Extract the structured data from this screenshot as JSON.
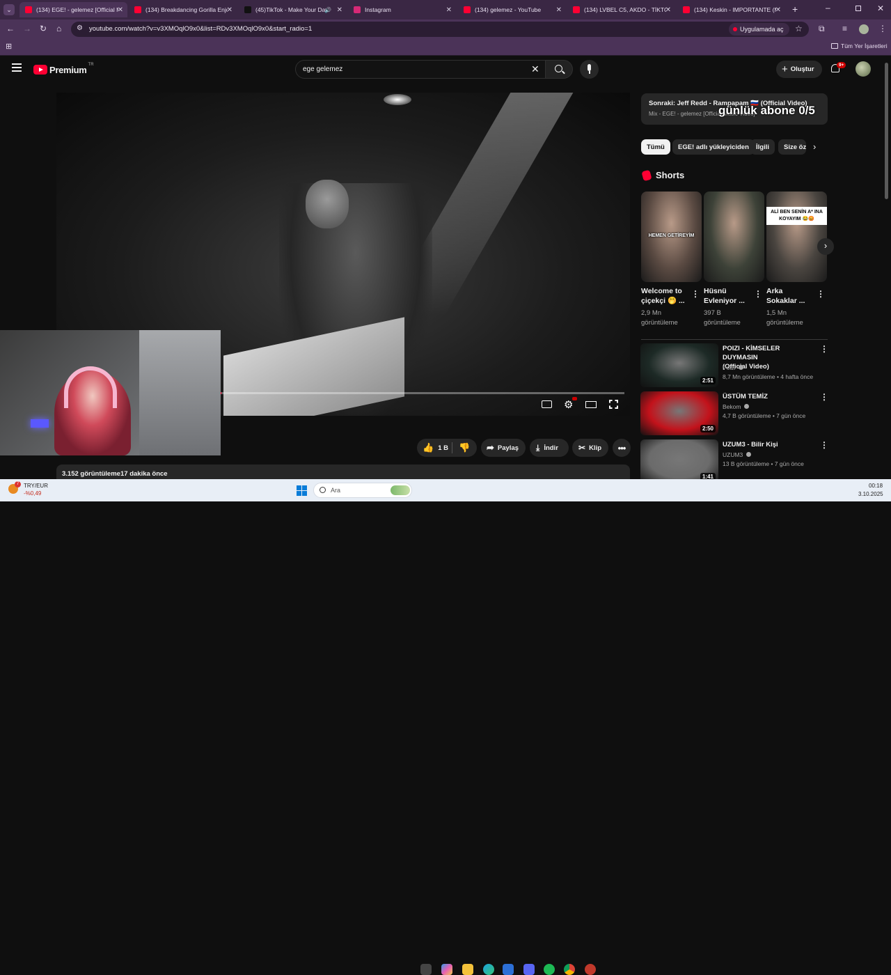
{
  "browser": {
    "tabs": [
      {
        "label": "(134) EGE! - gelemez [Official M",
        "fav": "#ff0033",
        "active": true
      },
      {
        "label": "(134) Breakdancing Gorilla Enjo",
        "fav": "#ff0033"
      },
      {
        "label": "(45)TikTok - Make Your Day",
        "fav": "#111111",
        "audio": "🔊"
      },
      {
        "label": "Instagram",
        "fav": "#d62976"
      },
      {
        "label": "(134) gelemez - YouTube",
        "fav": "#ff0033"
      },
      {
        "label": "(134) LVBEL C5, AKDO - TİKTOK",
        "fav": "#ff0033"
      },
      {
        "label": "(134) Keskin - IMPORTANTE (M",
        "fav": "#ff0033"
      }
    ],
    "new_tab": "+",
    "url": "youtube.com/watch?v=v3XMOqlO9x0&list=RDv3XMOqlO9x0&start_radio=1",
    "open_in_app": "Uygulamada aç",
    "bookmarks_label": "Tüm Yer İşaretleri"
  },
  "yt": {
    "logo_text": "Premium",
    "region": "TR",
    "search_value": "ege gelemez",
    "create_label": "Oluştur",
    "notif_badge": "9+"
  },
  "player": {
    "progress": 0.29
  },
  "actions": {
    "like_count": "1 B",
    "share_label": "Paylaş",
    "download_label": "İndir",
    "clip_label": "Klip"
  },
  "description": {
    "views": "3.152 görüntüleme",
    "time": "17 dakika önce"
  },
  "next_card": {
    "title": "Sonraki: Jeff Redd - Rampapam 🇷🇺 (Official Video)",
    "subtitle": "Mix - EGE! - gelemez [Official Music Video]",
    "overlay": "günlük abone 0/5"
  },
  "chips": [
    "Tümü",
    "EGE! adlı yükleyiciden",
    "İlgili",
    "Size öz"
  ],
  "shorts": {
    "heading": "Shorts",
    "items": [
      {
        "caption": "HEMEN GETİREYİM",
        "title1": "Welcome to",
        "title2": "çiçekçi 🤭 ...",
        "views": "2,9 Mn",
        "views2": "görüntüleme",
        "bg": "#5a4a42"
      },
      {
        "caption": "",
        "title1": "Hüsnü",
        "title2": "Evleniyor ...",
        "views": "397 B",
        "views2": "görüntüleme",
        "bg": "#3d4238"
      },
      {
        "caption": "ALİ BEN SENİN A* INA KOYAYIM 😂😡",
        "title1": "Arka",
        "title2": "Sokaklar ...",
        "views": "1,5 Mn",
        "views2": "görüntüleme",
        "bg": "#4a4540"
      }
    ]
  },
  "related": [
    {
      "title1": "POIZI - KİMSELER DUYMASIN",
      "title2": "(Official Video)",
      "channel": "Poizi",
      "meta": "8,7 Mn görüntüleme • 4 hafta önce",
      "duration": "2:51",
      "bg": "#1d2a26"
    },
    {
      "title1": "ÜSTÜM TEMİZ",
      "title2": "",
      "channel": "Bekom",
      "meta": "4,7 B görüntüleme • 7 gün önce",
      "duration": "2:50",
      "bg": "#c3121b"
    },
    {
      "title1": "UZUM3 - Bilir Kişi",
      "title2": "",
      "channel": "UZUM3",
      "meta": "13 B görüntüleme • 7 gün önce",
      "duration": "1:41",
      "bg": "#6b6b6b"
    }
  ],
  "taskbar": {
    "currency": "TRY/EUR",
    "change": "-%0,49",
    "badge": "7",
    "search_label": "Ara",
    "time": "00:18",
    "date": "3.10.2025"
  }
}
